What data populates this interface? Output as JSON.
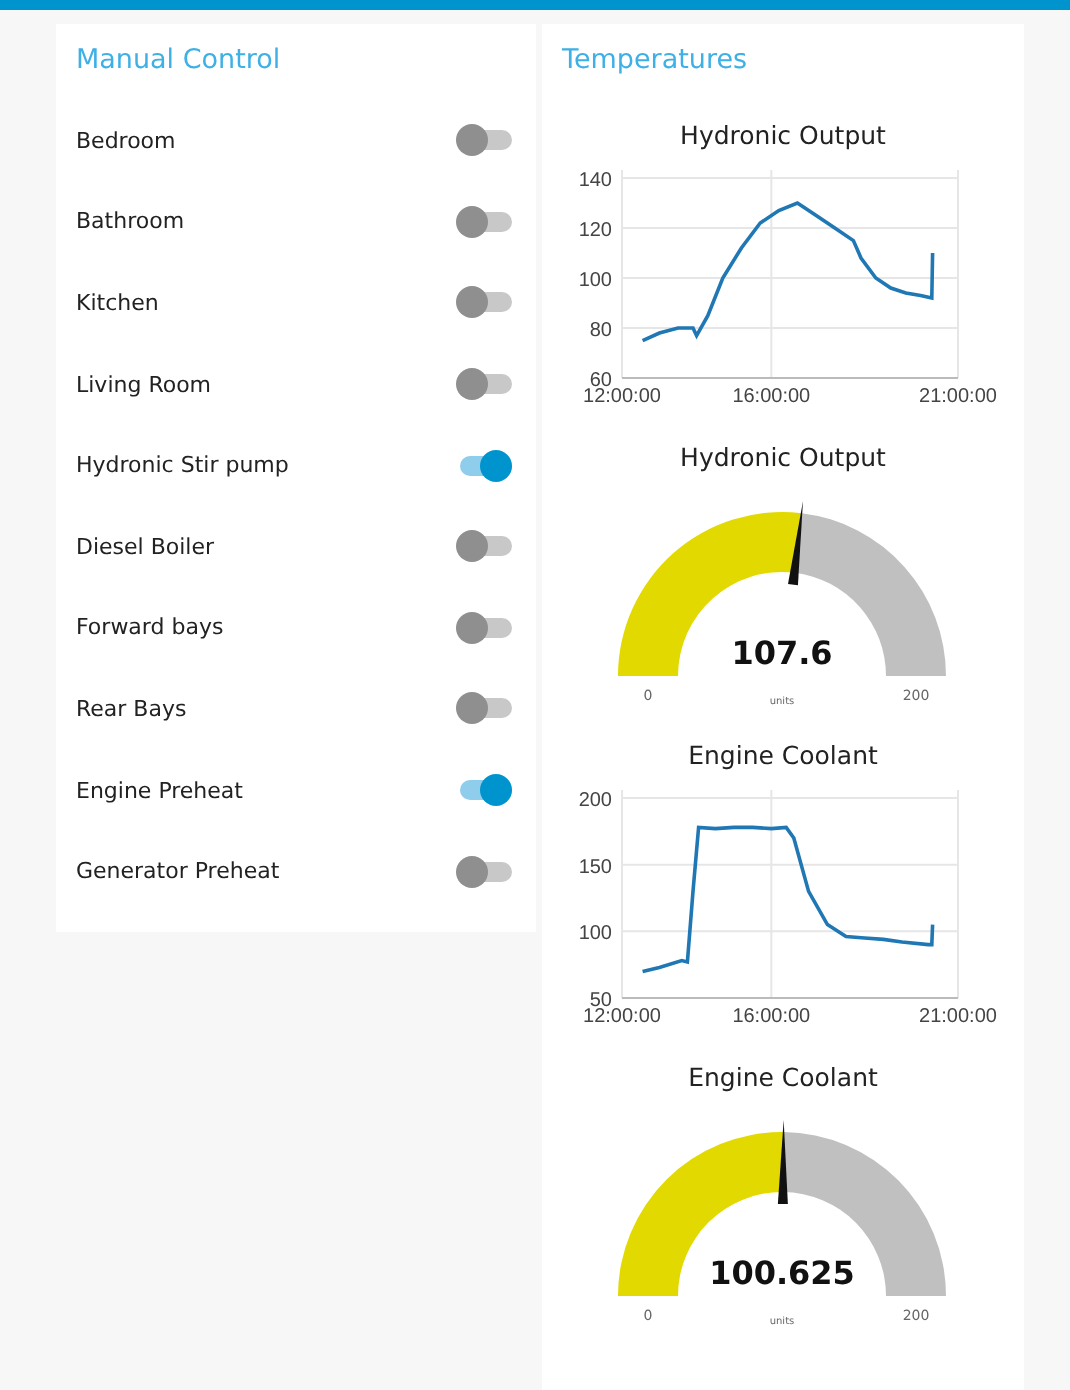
{
  "manual_control": {
    "title": "Manual Control",
    "switches": [
      {
        "label": "Bedroom",
        "on": false
      },
      {
        "label": "Bathroom",
        "on": false
      },
      {
        "label": "Kitchen",
        "on": false
      },
      {
        "label": "Living Room",
        "on": false
      },
      {
        "label": "Hydronic Stir pump",
        "on": true
      },
      {
        "label": "Diesel Boiler",
        "on": false
      },
      {
        "label": "Forward bays",
        "on": false
      },
      {
        "label": "Rear Bays",
        "on": false
      },
      {
        "label": "Engine Preheat",
        "on": true
      },
      {
        "label": "Generator Preheat",
        "on": false
      }
    ]
  },
  "temperatures": {
    "title": "Temperatures",
    "widgets": [
      {
        "kind": "chart",
        "title": "Hydronic Output",
        "chart_data": {
          "type": "line",
          "x": [
            12.55,
            13,
            13.5,
            13.9,
            14,
            14.3,
            14.7,
            15.2,
            15.7,
            16.2,
            16.7,
            17.2,
            17.7,
            18.2,
            18.4,
            18.8,
            19.2,
            19.6,
            20,
            20.3,
            20.32
          ],
          "grid": true,
          "series": [
            {
              "color": "#1f77b4",
              "values": [
                75,
                78,
                80,
                80,
                77,
                85,
                100,
                112,
                122,
                127,
                130,
                125,
                120,
                115,
                108,
                100,
                96,
                94,
                93,
                92,
                110
              ]
            }
          ],
          "xlim": [
            12,
            21
          ],
          "ylim": [
            60,
            140
          ],
          "xticks": [
            {
              "value": 12,
              "label": "12:00:00"
            },
            {
              "value": 16,
              "label": "16:00:00"
            },
            {
              "value": 21,
              "label": "21:00:00"
            }
          ],
          "yticks": [
            60,
            80,
            100,
            120,
            140
          ]
        }
      },
      {
        "kind": "gauge",
        "title": "Hydronic Output",
        "value": "107.6",
        "level": 0.538,
        "min": "0",
        "max": "200",
        "units": "units"
      },
      {
        "kind": "chart",
        "title": "Engine Coolant",
        "chart_data": {
          "type": "line",
          "x": [
            12.55,
            13,
            13.6,
            13.75,
            13.9,
            14.05,
            14.5,
            15,
            15.5,
            16,
            16.4,
            16.6,
            17,
            17.5,
            18,
            18.5,
            19,
            19.5,
            20.2,
            20.3,
            20.32
          ],
          "grid": true,
          "series": [
            {
              "color": "#1f77b4",
              "values": [
                70,
                73,
                78,
                77,
                130,
                178,
                177,
                178,
                178,
                177,
                178,
                170,
                130,
                105,
                96,
                95,
                94,
                92,
                90,
                90,
                105
              ]
            }
          ],
          "xlim": [
            12,
            21
          ],
          "ylim": [
            50,
            200
          ],
          "xticks": [
            {
              "value": 12,
              "label": "12:00:00"
            },
            {
              "value": 16,
              "label": "16:00:00"
            },
            {
              "value": 21,
              "label": "21:00:00"
            }
          ],
          "yticks": [
            50,
            100,
            150,
            200
          ]
        }
      },
      {
        "kind": "gauge",
        "title": "Engine Coolant",
        "value": "100.625",
        "level": 0.503,
        "min": "0",
        "max": "200",
        "units": "units"
      }
    ]
  }
}
